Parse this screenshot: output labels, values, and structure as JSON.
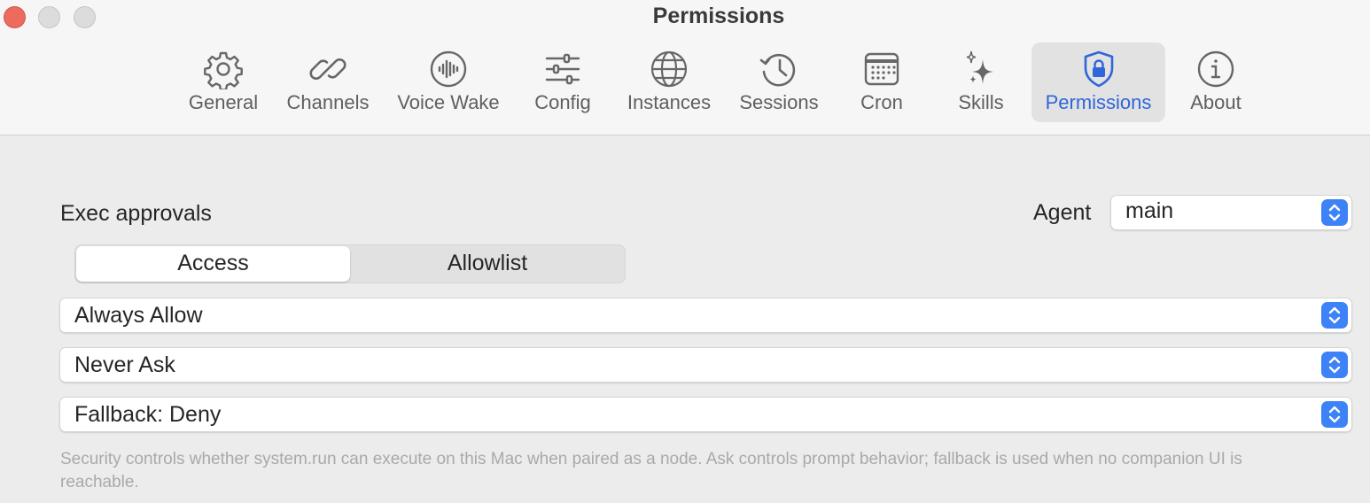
{
  "window": {
    "title": "Permissions"
  },
  "toolbar": {
    "tabs": [
      {
        "label": "General",
        "icon": "gear-icon"
      },
      {
        "label": "Channels",
        "icon": "link-icon"
      },
      {
        "label": "Voice Wake",
        "icon": "waveform-icon"
      },
      {
        "label": "Config",
        "icon": "sliders-icon"
      },
      {
        "label": "Instances",
        "icon": "globe-icon"
      },
      {
        "label": "Sessions",
        "icon": "history-clock-icon"
      },
      {
        "label": "Cron",
        "icon": "calendar-icon"
      },
      {
        "label": "Skills",
        "icon": "sparkles-icon"
      },
      {
        "label": "Permissions",
        "icon": "shield-lock-icon",
        "active": true
      },
      {
        "label": "About",
        "icon": "info-icon"
      }
    ]
  },
  "main": {
    "section_title": "Exec approvals",
    "agent": {
      "label": "Agent",
      "selected": "main"
    },
    "segments": {
      "selected": "Access",
      "other": "Allowlist"
    },
    "security_popup": {
      "selected": "Always Allow"
    },
    "ask_popup": {
      "selected": "Never Ask"
    },
    "fallback_popup": {
      "selected": "Fallback: Deny"
    },
    "help_text": "Security controls whether system.run can execute on this Mac when paired as a node. Ask controls prompt behavior; fallback is used when no companion UI is reachable."
  },
  "colors": {
    "accent": "#2f66d9",
    "stepper": "#3d82f6",
    "close": "#ed6a5e"
  }
}
